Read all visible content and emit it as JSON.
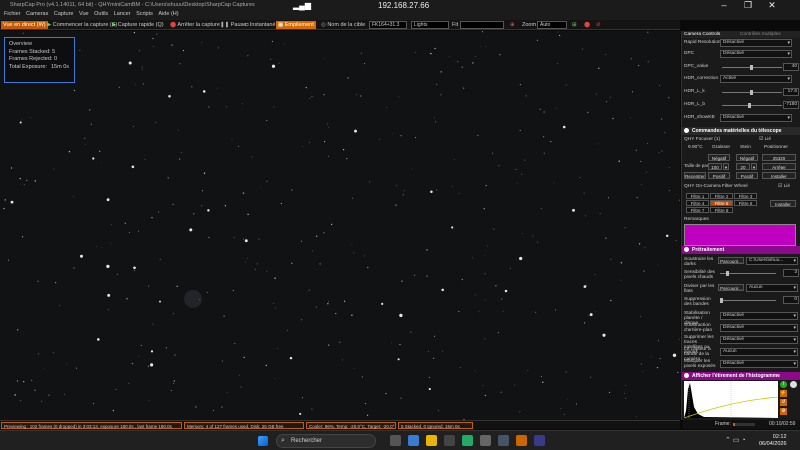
{
  "remote": {
    "ip": "192.168.27.66",
    "signal": "▂▄▆",
    "min": "–",
    "restore": "❐",
    "close": "✕"
  },
  "title": "SharpCap Pro (v4.1.14011, 64 bit) - QHYminiCamBM - C:\\Users\\shuuu\\Desktop\\SharpCap Captures",
  "menu": [
    "Fichier",
    "Cameras",
    "Capture",
    "Vue",
    "Outils",
    "Lancer",
    "Scripts",
    "Aide (H)"
  ],
  "toolbar": {
    "live": "Vue en direct (W)",
    "start_capture": "Commencer la capture (S)",
    "quick_capture": "Capture rapide (Q)",
    "stop_capture": "Arrêter la capture",
    "pause": "Pause",
    "snapshot": "Instantané",
    "stacking": "Empilement",
    "target_name_label": "Nom de la cible",
    "target_name_value": "FK164+31.3",
    "frame_type": "Lights",
    "fit_label": "Fit",
    "zoom_label": "Zoom",
    "zoom_value": "Auto"
  },
  "overview": {
    "title": "Overview",
    "stacked_label": "Frames Stacked:",
    "stacked": "5",
    "rejected_label": "Frames Rejected:",
    "rejected": "0",
    "exposure_label": "Total Exposure:",
    "exposure": "15m 0s"
  },
  "status": {
    "preview": "Previewing : 102 frames (0 dropped) in 3:03:13, exposure 180.0s , last frame 180.0s",
    "memory": "Memory: 4 of 127 frames used, Disk: 25 GB free",
    "cooler": "Cooler: 96%, Temp: -20.0°C, Target: -20.0°",
    "stacked": "5 Stacked, 0 Ignored, 15m 0s",
    "frame_label": "Frame:",
    "frame_time": "00:10/02:59"
  },
  "right": {
    "tab_cam": "Camera Controls",
    "tab_multi": "Contrôles multiples",
    "cam_rows": [
      {
        "label": "Rapid Resolution",
        "value": "Désactivé",
        "kind": "dd"
      },
      {
        "label": "DPC",
        "value": "Désactivé",
        "kind": "dd"
      },
      {
        "label": "DPC_value",
        "value": "40",
        "kind": "slider",
        "pos": 0.5
      },
      {
        "label": "HDR_correction",
        "value": "Activé",
        "kind": "dd"
      },
      {
        "label": "HDR_L_k",
        "value": "17.6",
        "kind": "slider",
        "pos": 0.5
      },
      {
        "label": "HDR_L_b",
        "value": "-7150",
        "kind": "slider",
        "pos": 0.45
      },
      {
        "label": "HDR_showKB",
        "value": "Désactivé",
        "kind": "dd"
      }
    ],
    "hw_title": "Commandes matérielles du télescope",
    "focuser": "QHY Focuser (1)",
    "focuser_link": "Lié",
    "temp": "9.90°C",
    "col_graisser": "Graisser",
    "col_stein": "Stein",
    "col_positionner": "Positionner",
    "neg1": "Négatif",
    "neg2": "Négatif",
    "pos_value": "25320",
    "pas_label": "Taille de pas",
    "pas1": "100",
    "pas2": "20",
    "arreter": "Arrêter",
    "recentrer": "Recentrer",
    "positif1": "Positif",
    "positif2": "Positif",
    "installer1": "Installer",
    "filterwheel": "QHY On-Camera Filter Wheel",
    "fw_link": "Lié",
    "filters": [
      "Filtre 1",
      "Filtre 2",
      "Filtre 3",
      "Filtre 4",
      "Filtre 5",
      "Filtre 6",
      "Filtre 7",
      "Filtre 8"
    ],
    "installer2": "Installer",
    "remarques": "Remarques",
    "pre_title": "Prétraitement",
    "pre_rows": [
      {
        "label": "Soustraire les darks",
        "btn": "Parcourir...",
        "value": "C:\\Users\\shuu..."
      },
      {
        "label": "Sensibilité des pixels chauds",
        "value": "3",
        "kind": "slider"
      },
      {
        "label": "Diviser par les flats",
        "btn": "Parcourir...",
        "value": "Aucun"
      },
      {
        "label": "Suppression des bandes",
        "value": "0",
        "kind": "slider"
      },
      {
        "label": "Stabilisation planète / disque",
        "value": "Désactivé"
      },
      {
        "label": "Soustraction d'arrière-plan",
        "value": "Désactivé"
      },
      {
        "label": "Supprimer les traces satellites ou avions",
        "value": "Désactivé"
      },
      {
        "label": "Le capteur à bande de la caméra",
        "value": "Aucun"
      },
      {
        "label": "Masquer les pixels exposés",
        "value": "Désactivé"
      }
    ],
    "hist_title": "Afficher l'étirement de l'histogramme"
  },
  "taskbar": {
    "search": "Rechercher",
    "time": "02:12",
    "date": "06/04/2026"
  },
  "colors": {
    "accent": "#c45a00",
    "magenta": "#8a0a8a",
    "overview_border": "#3b7bd6"
  }
}
